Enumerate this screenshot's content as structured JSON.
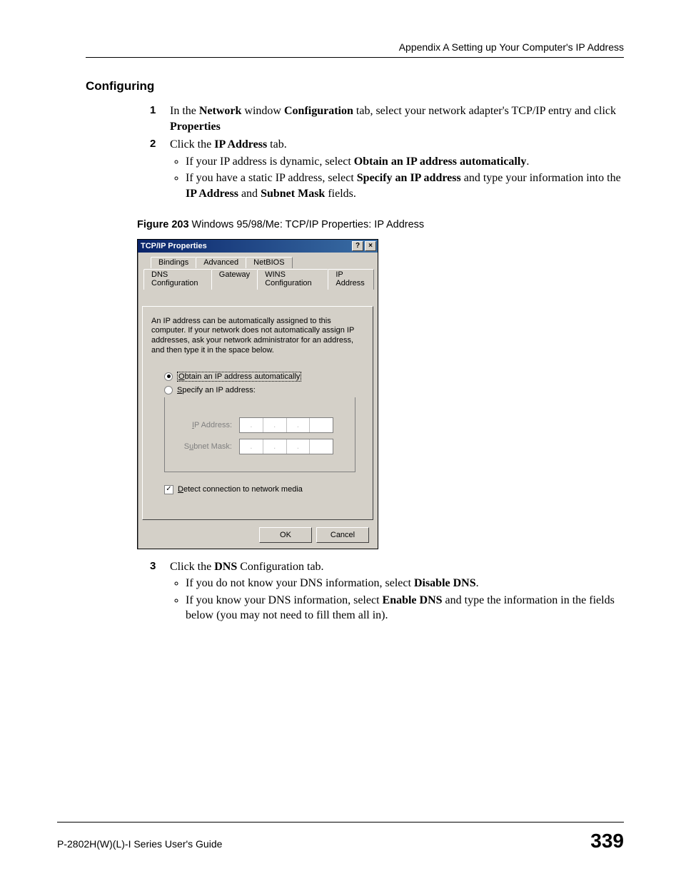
{
  "header": {
    "breadcrumb": "Appendix A Setting up Your Computer's IP Address"
  },
  "section": {
    "title": "Configuring"
  },
  "steps": {
    "s1": {
      "num": "1",
      "t1": "In the ",
      "b1": "Network",
      "t2": " window ",
      "b2": "Configuration",
      "t3": " tab, select your network adapter's TCP/IP entry and click ",
      "b3": "Properties"
    },
    "s2": {
      "num": "2",
      "t1": "Click the ",
      "b1": "IP Address",
      "t2": " tab.",
      "bul1_t1": "If your IP address is dynamic, select ",
      "bul1_b1": "Obtain an IP address automatically",
      "bul1_t2": ".",
      "bul2_t1": "If you have a static IP address, select ",
      "bul2_b1": "Specify an IP address",
      "bul2_t2": " and type your information into the ",
      "bul2_b2": "IP Address",
      "bul2_t3": " and ",
      "bul2_b3": "Subnet Mask",
      "bul2_t4": " fields."
    },
    "s3": {
      "num": "3",
      "t1": "Click the ",
      "b1": "DNS",
      "t2": " Configuration tab.",
      "bul1_t1": "If you do not know your DNS information, select ",
      "bul1_b1": "Disable DNS",
      "bul1_t2": ".",
      "bul2_t1": "If you know your DNS information, select ",
      "bul2_b1": "Enable DNS",
      "bul2_t2": " and type the information in the fields below (you may not need to fill them all in)."
    }
  },
  "figure": {
    "label": "Figure 203",
    "caption": "   Windows 95/98/Me: TCP/IP Properties: IP Address"
  },
  "dialog": {
    "title": "TCP/IP Properties",
    "help_icon": "?",
    "close_icon": "×",
    "tabs_back": [
      "Bindings",
      "Advanced",
      "NetBIOS"
    ],
    "tabs_front": [
      "DNS Configuration",
      "Gateway",
      "WINS Configuration",
      "IP Address"
    ],
    "description": "An IP address can be automatically assigned to this computer. If your network does not automatically assign IP addresses, ask your network administrator for an address, and then type it in the space below.",
    "radio_obtain_u": "O",
    "radio_obtain_rest": "btain an IP address automatically",
    "radio_specify_u": "S",
    "radio_specify_rest": "pecify an IP address:",
    "lbl_ip_u": "I",
    "lbl_ip_rest": "P Address:",
    "lbl_subnet_pre": "S",
    "lbl_subnet_u": "u",
    "lbl_subnet_rest": "bnet Mask:",
    "chk_detect_u": "D",
    "chk_detect_rest": "etect connection to network media",
    "chk_mark": "✓",
    "ok": "OK",
    "cancel": "Cancel",
    "dot": "."
  },
  "footer": {
    "guide": "P-2802H(W)(L)-I Series User's Guide",
    "page": "339"
  }
}
